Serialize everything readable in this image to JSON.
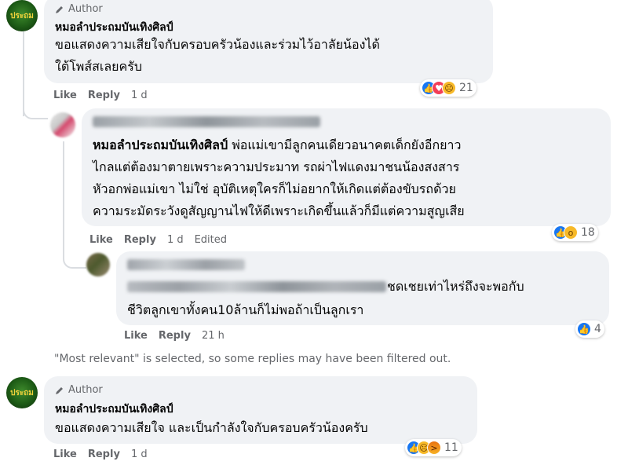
{
  "comments": [
    {
      "author_badge": "Author",
      "name": "หมอลำประถมบันเทิงศิลป์",
      "avatar_text": "ประถม",
      "lines": [
        "ขอแสดงความเสียใจกับครอบครัวน้องและร่วมไว้อาลัยน้องได้",
        "ใต้โพส์สเลยครับ"
      ],
      "like": "Like",
      "reply": "Reply",
      "time": "1 d",
      "reaction_count": "21",
      "reactions": [
        "like-icon",
        "love-icon",
        "sad-icon"
      ]
    },
    {
      "name": "หมอลำประถมบันเทิงศิลป์",
      "lines": [
        "พ่อแม่เขามีลูกคนเดียวอนาคตเด็กยังอีกยาว",
        "ไกลแต่ต้องมาตายเพราะความประมาท รถผ่าไฟแดงมาชนน้องสงสาร",
        "หัวอกพ่อแม่เขา ไม่ใช่ อุบัติเหตุใครก็ไม่อยากให้เกิดแต่ต้องขับรถด้วย",
        "ความระมัดระวังดูสัญญานไฟให้ดีเพราะเกิดขึ้นแล้วก็มีแต่ความสูญเสีย"
      ],
      "like": "Like",
      "reply": "Reply",
      "time": "1 d",
      "edited": "Edited",
      "reaction_count": "18",
      "reactions": [
        "like-icon",
        "wow-icon"
      ]
    },
    {
      "lines_visible": [
        "ชดเชยเท่าไหร่ถึงจะพอกับ",
        "ชีวิตลูกเขาทั้งคน10ล้านก็ไม่พอถ้าเป็นลูกเรา"
      ],
      "like": "Like",
      "reply": "Reply",
      "time": "21 h",
      "reaction_count": "4",
      "reactions": [
        "like-icon"
      ]
    },
    {
      "author_badge": "Author",
      "name": "หมอลำประถมบันเทิงศิลป์",
      "avatar_text": "ประถม",
      "lines": [
        "ขอแสดงความเสียใจ และเป็นกำลังใจกับครอบครัวน้องครับ"
      ],
      "like": "Like",
      "reply": "Reply",
      "time": "1 d",
      "reaction_count": "11",
      "reactions": [
        "like-icon",
        "sad-icon",
        "angry-icon"
      ]
    }
  ],
  "filter_note": "\"Most relevant\" is selected, so some replies may have been filtered out.",
  "colors": {
    "bubble": "#f0f2f5",
    "meta_text": "#65676b",
    "like_blue": "#1877f2"
  }
}
